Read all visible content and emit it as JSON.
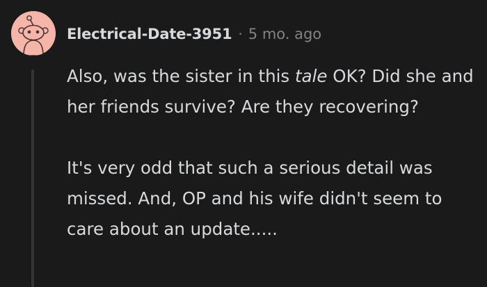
{
  "comment": {
    "author": "Electrical-Date-3951",
    "separator": "·",
    "age": "5 mo. ago",
    "avatar_icon": "snoo-avatar-icon",
    "avatar_color": "#f5b5a8",
    "paragraph_1": {
      "before": "Also, was the sister in this ",
      "emphasis": "tale",
      "after": " OK? Did she and her friends survive? Are they recovering?"
    },
    "paragraph_2": "It's very odd that such a serious detail was missed. And, OP and his wife didn't seem to care about an update....."
  },
  "colors": {
    "background": "#1a1a1b",
    "text": "#d7dadc",
    "muted": "#818384",
    "thread_line": "#343536"
  }
}
